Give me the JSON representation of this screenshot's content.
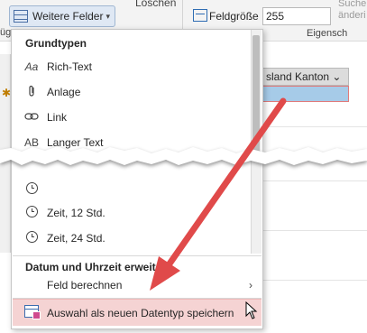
{
  "ribbon": {
    "weitere_felder_label": "Weitere Felder",
    "loeschen_label": "Löschen",
    "feldgroesse_label": "Feldgröße",
    "feldgroesse_value": "255",
    "suche_line1": "Suche",
    "suche_line2": "änderi",
    "eigenschaften_label": "Eigensch",
    "left_cut_label": "üg"
  },
  "table": {
    "column_header": "sland Kanton",
    "new_row_marker": "✱"
  },
  "menu": {
    "section_grundtypen": "Grundtypen",
    "section_datum": "Datum und Uhrzeit erweitert",
    "items_grundtypen": [
      {
        "icon": "Aa",
        "label": "Rich-Text",
        "mnemonic_index": 0
      },
      {
        "icon": "paperclip-icon",
        "label": "Anlage",
        "mnemonic_index": 2
      },
      {
        "icon": "link-icon",
        "label": "Link",
        "mnemonic_index": 0
      },
      {
        "icon": "AB",
        "label": "Langer Text",
        "mnemonic_index": 0
      }
    ],
    "items_zeit": [
      {
        "label": "Zeit, 12 Std."
      },
      {
        "label": "Zeit, 24 Std."
      }
    ],
    "item_feld_berechnen": "Feld berechnen",
    "item_save_datatype": "Auswahl als neuen Datentyp speichern"
  },
  "colors": {
    "accent_highlight": "#f5d3d3",
    "arrow": "#e04a4a",
    "selection_fill": "#a6cbe8"
  }
}
